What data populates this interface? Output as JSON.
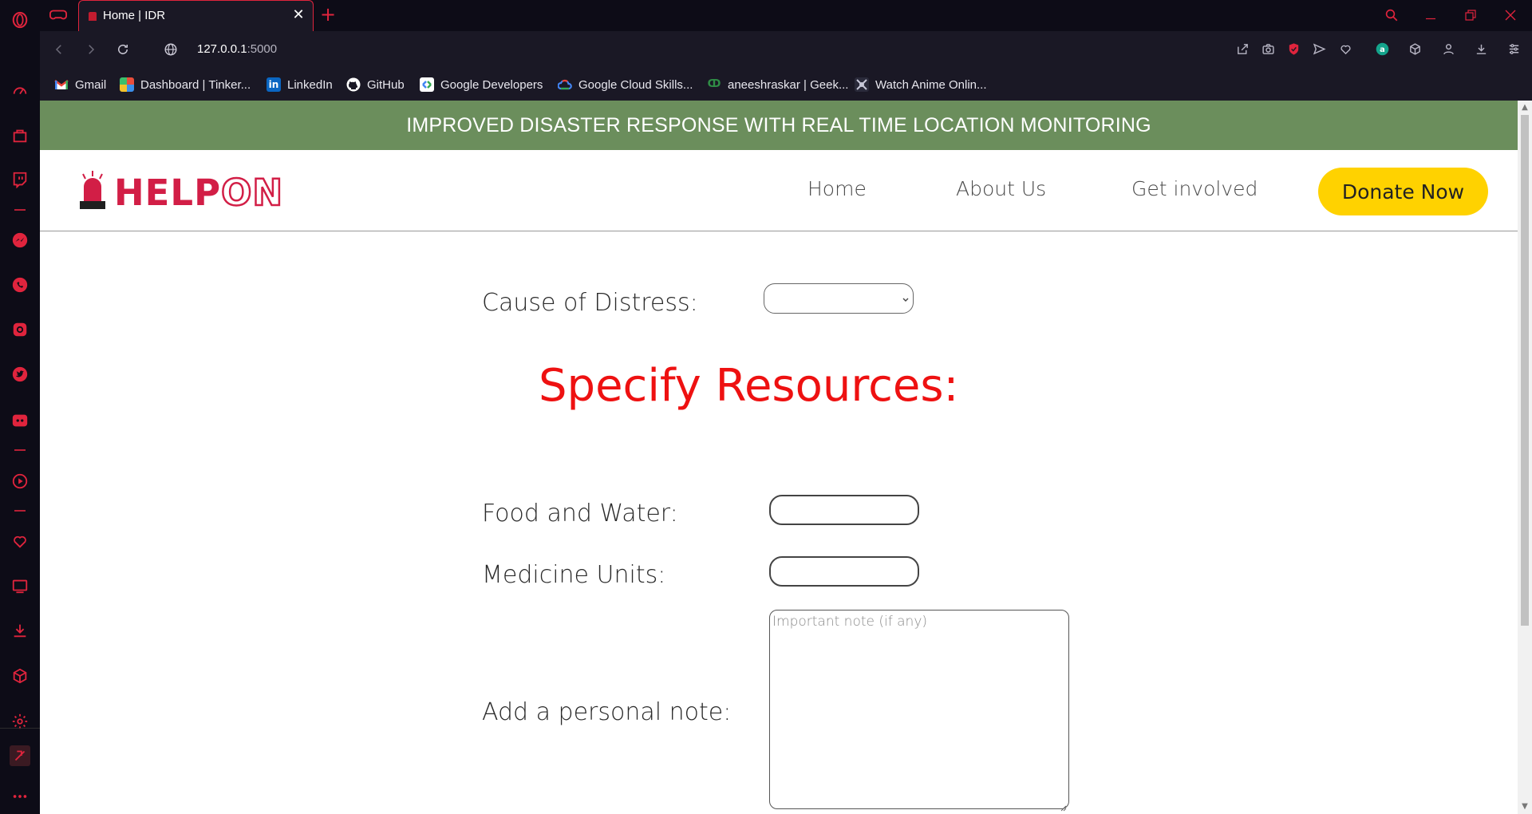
{
  "browser": {
    "tab": {
      "title": "Home | IDR",
      "close": "✕"
    },
    "new_tab": "+",
    "url_host": "127.0.0.1",
    "url_port": ":5000",
    "bookmarks": [
      {
        "label": "Gmail",
        "icon": "gmail-icon"
      },
      {
        "label": "Dashboard | Tinker...",
        "icon": "tinkercad-icon"
      },
      {
        "label": "LinkedIn",
        "icon": "linkedin-icon"
      },
      {
        "label": "GitHub",
        "icon": "github-icon"
      },
      {
        "label": "Google Developers",
        "icon": "google-developers-icon"
      },
      {
        "label": "Google Cloud Skills...",
        "icon": "google-cloud-icon"
      },
      {
        "label": "aneeshraskar | Geek...",
        "icon": "geeksforgeeks-icon"
      },
      {
        "label": "Watch Anime Onlin...",
        "icon": "anime-site-icon"
      }
    ],
    "accent_color": "#e0243d"
  },
  "site": {
    "banner": "IMPROVED DISASTER RESPONSE WITH REAL TIME LOCATION MONITORING",
    "logo_text_1": "HELP",
    "logo_text_2": "ON",
    "nav": {
      "home": "Home",
      "about": "About Us",
      "involved": "Get involved"
    },
    "donate_label": "Donate Now",
    "colors": {
      "banner": "#6b8e5c",
      "brand": "#d21e46",
      "donate": "#ffd200",
      "heading": "#ee1111"
    }
  },
  "form": {
    "cause_label": "Cause of Distress:",
    "cause_value": "",
    "heading": "Specify Resources:",
    "food_label": "Food and Water:",
    "food_value": "",
    "medicine_label": "Medicine Units:",
    "medicine_value": "",
    "note_label": "Add a personal note:",
    "note_placeholder": "Important note (if any)"
  }
}
